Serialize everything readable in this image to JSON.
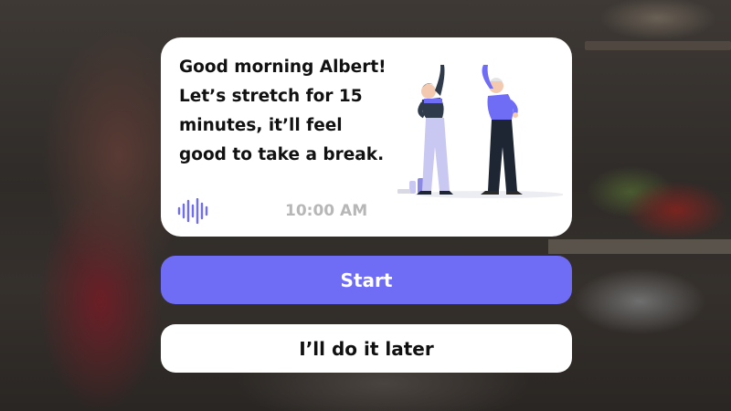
{
  "notification": {
    "message": "Good morning Albert! Let’s stretch for 15 minutes, it’ll feel good to take a break.",
    "time": "10:00 AM",
    "audio_icon": "voice-waveform-icon",
    "illustration": "two-seniors-stretching"
  },
  "actions": {
    "start_label": "Start",
    "later_label": "I’ll do it later"
  },
  "colors": {
    "accent": "#6f6cf6",
    "card": "#ffffff",
    "time_text": "#b7b7b7",
    "overlay": "#2f2b28"
  }
}
